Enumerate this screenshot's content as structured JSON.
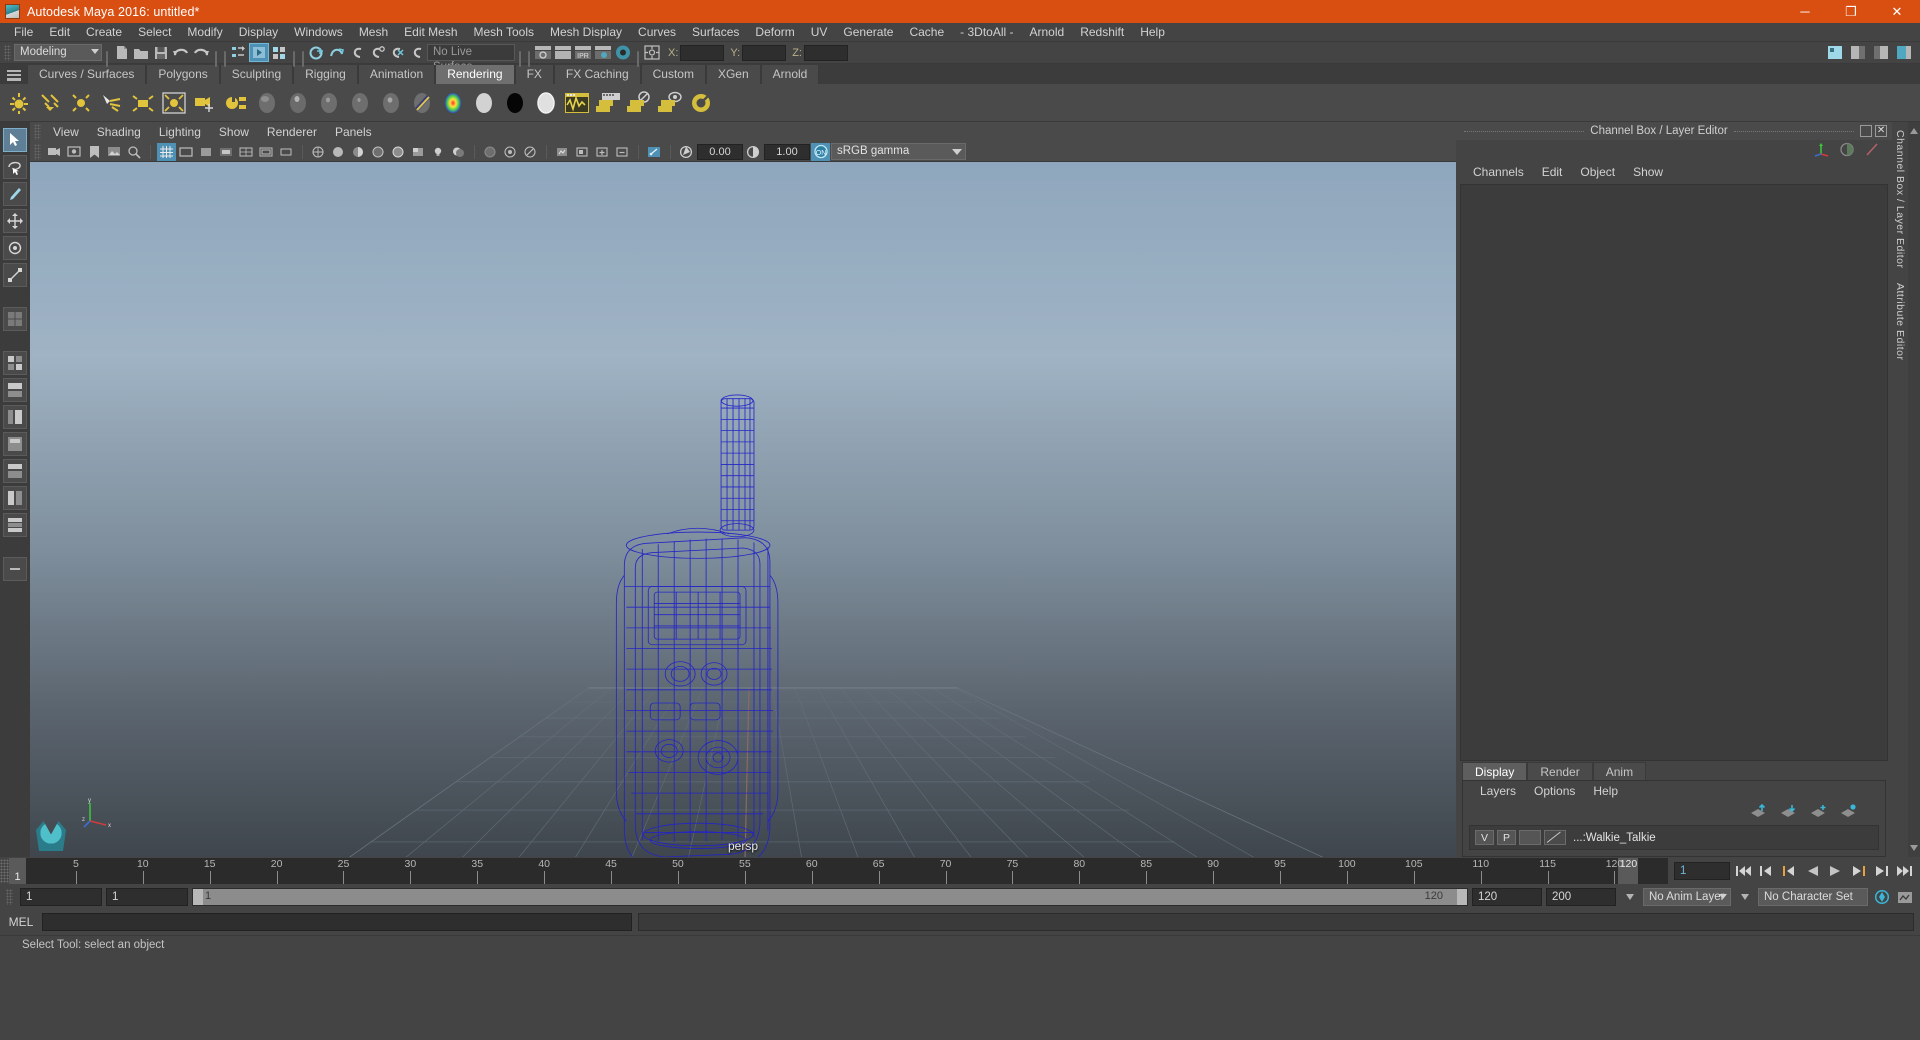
{
  "window": {
    "title": "Autodesk Maya 2016: untitled*",
    "app_icon": "maya-logo-icon",
    "controls": {
      "minimize": "─",
      "maximize": "❐",
      "close": "✕"
    },
    "accent": "#d94f12"
  },
  "menubar": {
    "items": [
      "File",
      "Edit",
      "Create",
      "Select",
      "Modify",
      "Display",
      "Windows",
      "Mesh",
      "Edit Mesh",
      "Mesh Tools",
      "Mesh Display",
      "Curves",
      "Surfaces",
      "Deform",
      "UV",
      "Generate",
      "Cache",
      "- 3DtoAll -",
      "Arnold",
      "Redshift",
      "Help"
    ]
  },
  "statusline": {
    "menuset": "Modeling",
    "live_surface": "No Live Surface",
    "coords": {
      "x_label": "X:",
      "y_label": "Y:",
      "z_label": "Z:",
      "x_value": "",
      "y_value": "",
      "z_value": ""
    }
  },
  "shelf": {
    "tabs": [
      "Curves / Surfaces",
      "Polygons",
      "Sculpting",
      "Rigging",
      "Animation",
      "Rendering",
      "FX",
      "FX Caching",
      "Custom",
      "XGen",
      "Arnold"
    ],
    "active_tab": "Rendering",
    "icons": [
      "point-light-icon",
      "directional-light-icon",
      "ambient-light-icon",
      "spot-light-icon",
      "area-light-icon",
      "volume-light-icon",
      "camera-icon",
      "light-linking-icon",
      "lambert-material-icon",
      "blinn-material-icon",
      "phong-material-icon",
      "phonge-material-icon",
      "anisotropic-material-icon",
      "layered-shader-icon",
      "ramp-shader-icon",
      "surface-shader-icon",
      "use-background-icon",
      "shading-map-icon",
      "hypershade-icon",
      "render-view-icon",
      "render-current-frame-icon",
      "ipr-render-icon",
      "render-settings-icon",
      "toggle-render-icon"
    ]
  },
  "toolbox": {
    "items": [
      "select-tool",
      "lasso-select-tool",
      "paint-select-tool",
      "move-tool",
      "rotate-tool",
      "scale-tool",
      "soft-select-tool",
      "last-tool-icon",
      "four-view-layout",
      "two-pane-stacked-layout",
      "single-perspective-layout",
      "outliner-persp-layout",
      "persp-graph-layout",
      "hypershade-persp-layout",
      "two-pane-side-layout",
      "four-pane-layout",
      "expand-layout"
    ],
    "selected": "select-tool"
  },
  "viewport": {
    "panel_menus": [
      "View",
      "Shading",
      "Lighting",
      "Show",
      "Renderer",
      "Panels"
    ],
    "exposure": "0.00",
    "gamma_value": "1.00",
    "color_management": "sRGB gamma",
    "camera_label": "persp",
    "gizmo_axes": [
      "x",
      "y",
      "z"
    ],
    "object": "Walkie_Talkie wireframe",
    "wire_color": "#2323c8"
  },
  "channelbox": {
    "panel_title": "Channel Box / Layer Editor",
    "menus": [
      "Channels",
      "Edit",
      "Object",
      "Show"
    ],
    "tool_icons": [
      "channel-box-icon",
      "attribute-editor-icon",
      "modeling-toolkit-icon"
    ],
    "window_buttons": [
      "undock-icon",
      "close-icon"
    ]
  },
  "layer_editor": {
    "tabs": [
      "Display",
      "Render",
      "Anim"
    ],
    "active_tab": "Display",
    "menus": [
      "Layers",
      "Options",
      "Help"
    ],
    "tools": [
      "move-layer-up-icon",
      "move-layer-down-icon",
      "new-layer-icon",
      "new-layer-from-selected-icon"
    ],
    "layers": [
      {
        "visibility": "V",
        "playback": "P",
        "shading": "",
        "name": "...:Walkie_Talkie"
      }
    ]
  },
  "side_tabs": [
    "Channel Box / Layer Editor",
    "Attribute Editor"
  ],
  "timeline": {
    "tick_labels": [
      "5",
      "10",
      "15",
      "20",
      "25",
      "30",
      "35",
      "40",
      "45",
      "50",
      "55",
      "60",
      "65",
      "70",
      "75",
      "80",
      "85",
      "90",
      "95",
      "100",
      "105",
      "110",
      "115",
      "120"
    ],
    "current_frame_marker": "1",
    "end_marker": "120",
    "frame_field": "1",
    "transport": [
      "go-to-start-icon",
      "step-back-key-icon",
      "step-back-frame-icon",
      "play-backwards-icon",
      "play-forwards-icon",
      "step-forward-frame-icon",
      "step-forward-key-icon",
      "go-to-end-icon"
    ]
  },
  "range": {
    "start": "1",
    "range_start": "1",
    "slider_left_label": "1",
    "slider_right_label": "120",
    "range_end": "120",
    "end": "200",
    "anim_layer": "No Anim Layer",
    "character_set": "No Character Set",
    "auto_key_icon": "auto-keyframe-icon",
    "prefs_icon": "animation-preferences-icon"
  },
  "command_line": {
    "language": "MEL",
    "input_value": "",
    "output_value": ""
  },
  "status_bar": {
    "message": "Select Tool: select an object"
  }
}
